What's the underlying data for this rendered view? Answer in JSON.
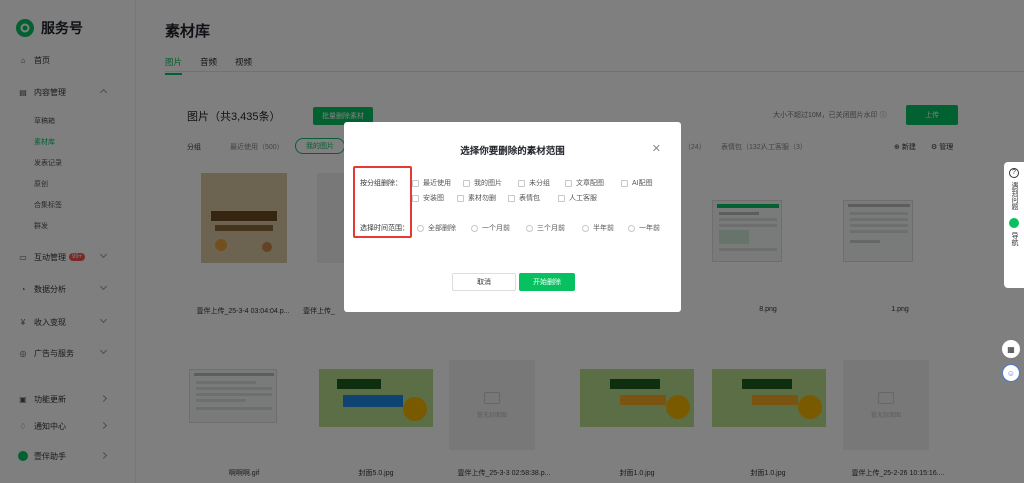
{
  "brand": {
    "name": "服务号"
  },
  "sidebar": {
    "home": "首页",
    "content": "内容管理",
    "content_sub": [
      "草稿箱",
      "素材库",
      "发表记录",
      "原创",
      "合集标签",
      "群发"
    ],
    "interact": "互动管理",
    "interact_badge": "99+",
    "data": "数据分析",
    "income": "收入变现",
    "ads": "广告与服务",
    "updates": "功能更新",
    "notify": "通知中心",
    "helper": "壹伴助手"
  },
  "main": {
    "title": "素材库",
    "tabs": [
      "图片",
      "音频",
      "视频"
    ],
    "count": "图片（共3,435条）",
    "batch_delete": "批量删除素材",
    "hint": "大小不超过10M，已关闭图片水印",
    "upload": "上传",
    "group_label": "分组",
    "filters": [
      "最近使用（500）",
      "我的图片",
      "（24）",
      "表情包（132）",
      "人工客服（3）"
    ],
    "new": "新建",
    "manage": "管理",
    "captions_row1": [
      "壹伴上传_25-3-4 03:04:04.p...",
      "壹伴上传_",
      "8.png",
      "1.png"
    ],
    "captions_row2": [
      "啊啊啊.gif",
      "封面5.0.jpg",
      "壹伴上传_25-3-3 02:58:38.p...",
      "封面1.0.jpg",
      "封面1.0.jpg",
      "壹伴上传_25-2-26 10:15:16...."
    ],
    "placeholder_text": "暂无封面图"
  },
  "modal": {
    "title": "选择你要删除的素材范围",
    "group_label": "按分组删除：",
    "groups_row1": [
      "最近使用",
      "我的图片",
      "未分组",
      "文章配图",
      "AI配图"
    ],
    "groups_row2": [
      "安装图",
      "素材勿删",
      "表情包",
      "人工客服"
    ],
    "time_label": "选择时间范围：",
    "time_options": [
      "全部删除",
      "一个月前",
      "三个月前",
      "半年前",
      "一年前"
    ],
    "cancel": "取消",
    "start": "开始删除"
  },
  "floatbar": {
    "help": "遇到问题",
    "nav": "导航"
  }
}
